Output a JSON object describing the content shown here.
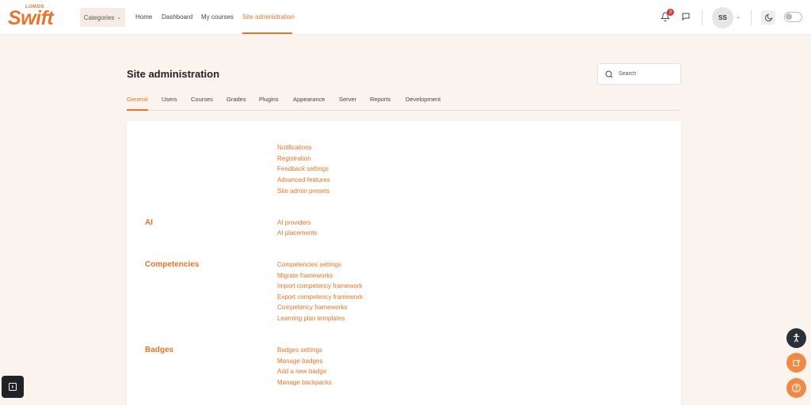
{
  "brand": {
    "logo_small": "LUMOS",
    "logo_big": "Swift",
    "accent_color": "#e8752a"
  },
  "navbar": {
    "categories_label": "Categories",
    "links": [
      {
        "label": "Home"
      },
      {
        "label": "Dashboard"
      },
      {
        "label": "My courses"
      },
      {
        "label": "Site administration"
      }
    ],
    "notification_count": "3",
    "avatar_initials": "SS"
  },
  "page": {
    "title": "Site administration",
    "search_placeholder": "Search"
  },
  "tabs": [
    {
      "label": "General"
    },
    {
      "label": "Users"
    },
    {
      "label": "Courses"
    },
    {
      "label": "Grades"
    },
    {
      "label": "Plugins"
    },
    {
      "label": "Appearance"
    },
    {
      "label": "Server"
    },
    {
      "label": "Reports"
    },
    {
      "label": "Development"
    }
  ],
  "sections": {
    "general_links": [
      "Notifications",
      "Registration",
      "Feedback settings",
      "Advanced features",
      "Site admin presets"
    ],
    "ai": {
      "title": "AI",
      "links": [
        "AI providers",
        "AI placements"
      ]
    },
    "competencies": {
      "title": "Competencies",
      "links": [
        "Competencies settings",
        "Migrate frameworks",
        "Import competency framework",
        "Export competency framework",
        "Competency frameworks",
        "Learning plan templates"
      ]
    },
    "badges": {
      "title": "Badges",
      "links": [
        "Badges settings",
        "Manage badges",
        "Add a new badge",
        "Manage backpacks"
      ]
    }
  }
}
